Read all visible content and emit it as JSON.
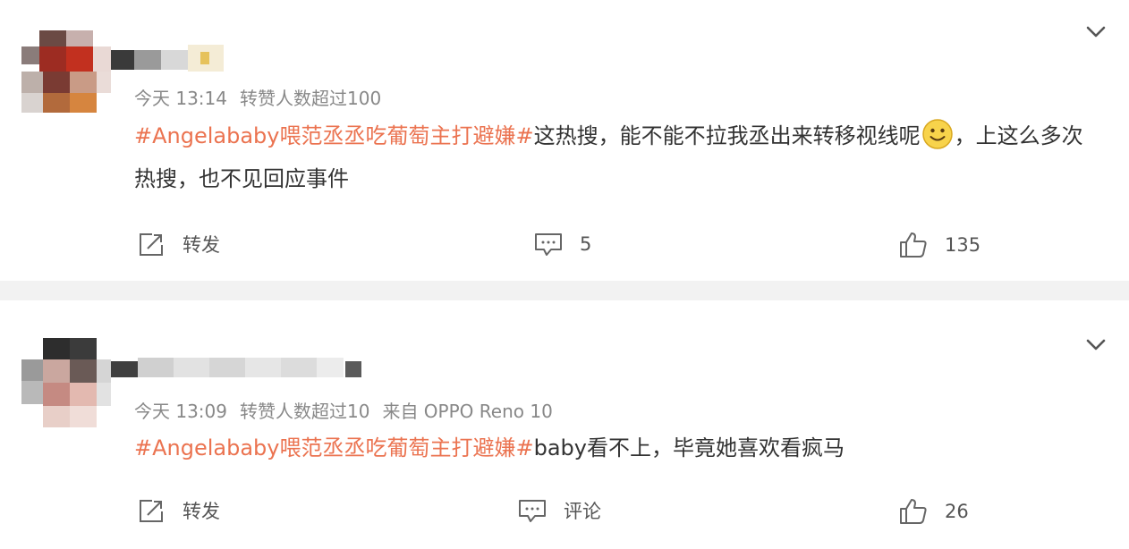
{
  "comments": [
    {
      "username": "",
      "time": "今天 13:14",
      "forward_note": "转赞人数超过100",
      "source": "",
      "topic": "#Angelababy喂范丞丞吃葡萄主打避嫌#",
      "text_before_emoji": "这热搜，能不能不拉我丞出来转移视线呢",
      "emoji": "smile-emoji",
      "text_after_emoji": "，上这么多次热搜，也不见回应事件",
      "repost_label": "转发",
      "comment_label": "5",
      "like_count": "135"
    },
    {
      "username": "",
      "time": "今天 13:09",
      "forward_note": "转赞人数超过10",
      "source": "来自 OPPO Reno 10",
      "topic": "#Angelababy喂范丞丞吃葡萄主打避嫌#",
      "text_before_emoji": "baby看不上，毕竟她喜欢看疯马",
      "emoji": "",
      "text_after_emoji": "",
      "repost_label": "转发",
      "comment_label": "评论",
      "like_count": "26"
    }
  ],
  "colors": {
    "topic": "#eb7350",
    "meta": "#888888",
    "text": "#333333",
    "divider": "#f2f2f2"
  },
  "icons": [
    "chevron-down-icon",
    "repost-icon",
    "comment-icon",
    "like-icon"
  ]
}
